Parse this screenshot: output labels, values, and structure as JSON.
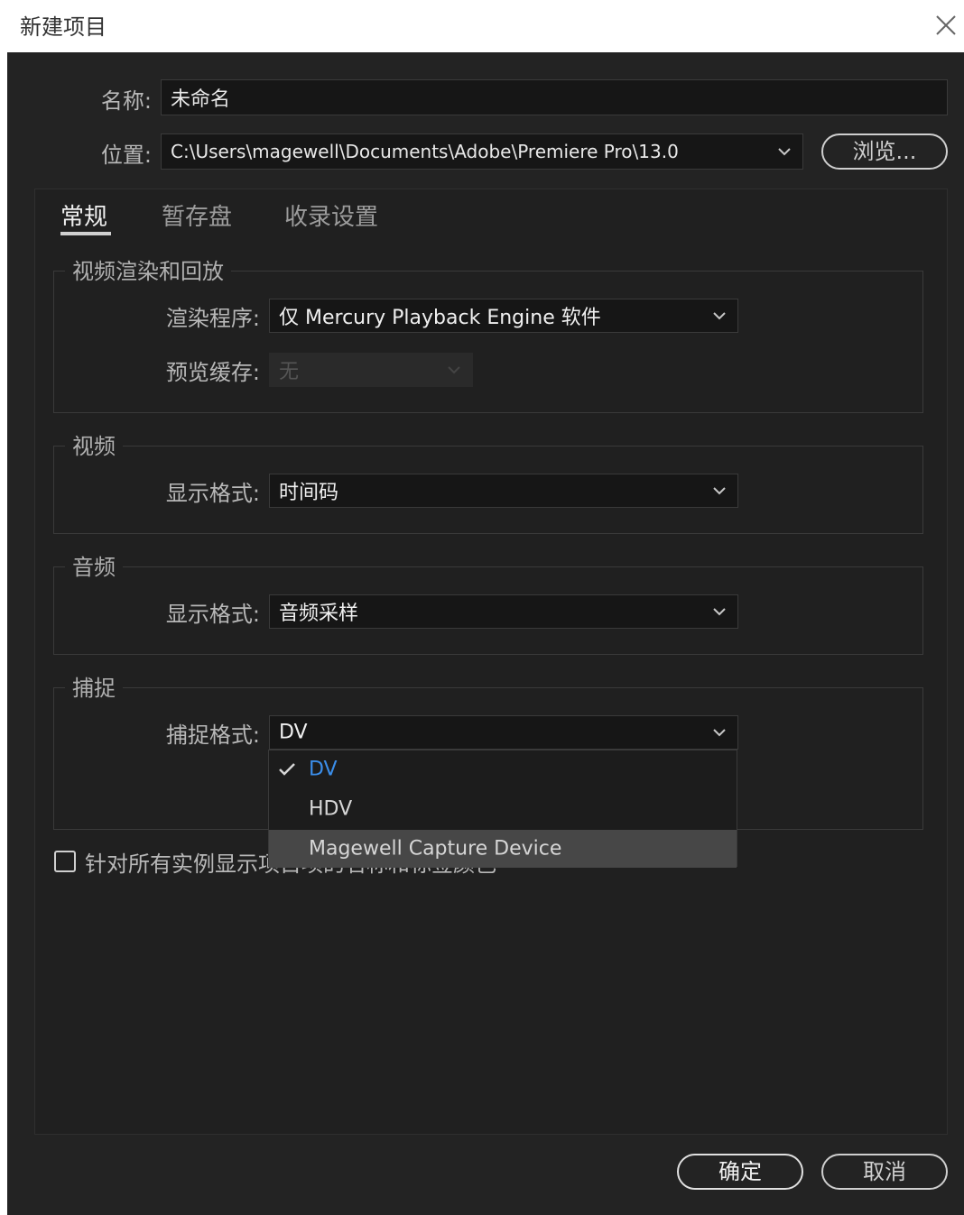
{
  "window": {
    "title": "新建项目"
  },
  "name_field": {
    "label": "名称:",
    "value": "未命名"
  },
  "location_field": {
    "label": "位置:",
    "value": "C:\\Users\\magewell\\Documents\\Adobe\\Premiere Pro\\13.0"
  },
  "browse_button": "浏览...",
  "tabs": [
    {
      "label": "常规",
      "active": true
    },
    {
      "label": "暂存盘",
      "active": false
    },
    {
      "label": "收录设置",
      "active": false
    }
  ],
  "video_rendering": {
    "title": "视频渲染和回放",
    "renderer": {
      "label": "渲染程序:",
      "value": "仅 Mercury Playback Engine 软件"
    },
    "preview_cache": {
      "label": "预览缓存:",
      "value": "无"
    }
  },
  "video": {
    "title": "视频",
    "display_format": {
      "label": "显示格式:",
      "value": "时间码"
    }
  },
  "audio": {
    "title": "音频",
    "display_format": {
      "label": "显示格式:",
      "value": "音频采样"
    }
  },
  "capture": {
    "title": "捕捉",
    "format": {
      "label": "捕捉格式:",
      "value": "DV"
    },
    "options": [
      "DV",
      "HDV",
      "Magewell Capture Device"
    ]
  },
  "checkbox_label": "针对所有实例显示项目项的名称和标签颜色",
  "buttons": {
    "ok": "确定",
    "cancel": "取消"
  },
  "icons": {
    "close": "close-icon",
    "chevron": "chevron-down-icon",
    "check": "checkmark-icon"
  },
  "colors": {
    "background": "#232323",
    "selected_option": "#3b8eea",
    "hover_option": "#474747"
  }
}
